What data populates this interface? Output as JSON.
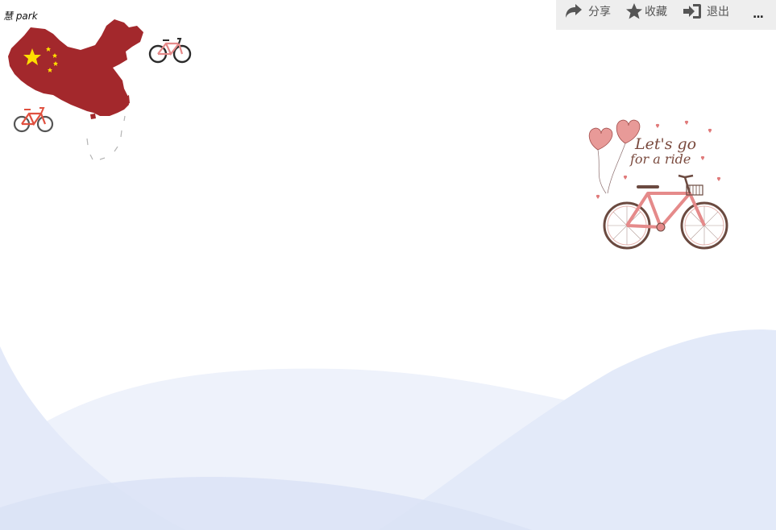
{
  "brand": {
    "text": "慧 park"
  },
  "toolbar": {
    "share": {
      "label": "分享",
      "icon": "share-icon"
    },
    "favorite": {
      "label": "收藏",
      "icon": "star-icon"
    },
    "exit": {
      "label": "退出",
      "icon": "sign-in-icon"
    },
    "more": {
      "label": "...",
      "icon": "more-icon"
    }
  },
  "illustration": {
    "line1": "Let's go",
    "line2": "for a ride"
  },
  "colors": {
    "toolbar_bg": "#eeeeee",
    "map_red": "#a3282c",
    "star_yellow": "#ffde00",
    "wave_blue": "#dfe7f8",
    "bike_pink": "#e58a8a"
  }
}
